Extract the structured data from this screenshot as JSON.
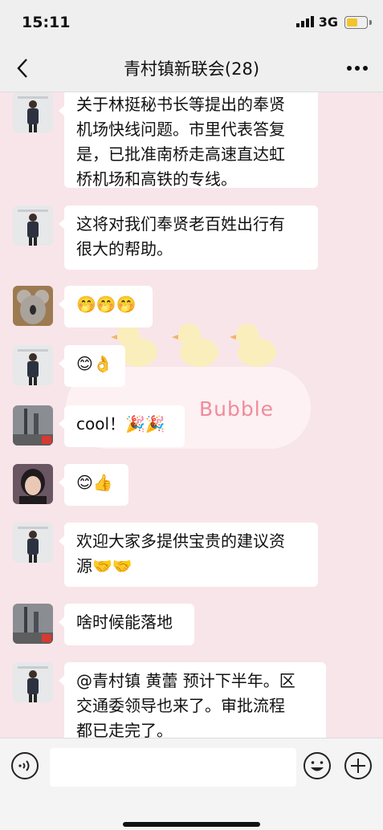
{
  "status": {
    "time": "15:11",
    "network": "3G"
  },
  "header": {
    "title": "青村镇新联会(28)"
  },
  "messages": [
    {
      "text": "关于林挺秘书长等提出的奉贤\n机场快线问题。市里代表答复\n是，已批准南桥走高速直达虹\n桥机场和高铁的专线。",
      "avatar": "man-photo-avatar"
    },
    {
      "text": "这将对我们奉贤老百姓出行有\n很大的帮助。",
      "avatar": "man-photo-avatar"
    },
    {
      "text": "🤭🤭🤭",
      "avatar": "koala-avatar"
    },
    {
      "text": "😊👌",
      "avatar": "man-photo-avatar"
    },
    {
      "text": "cool！🎉🎉",
      "avatar": "city-avatar"
    },
    {
      "text": "😊👍",
      "avatar": "woman-avatar"
    },
    {
      "text": "欢迎大家多提供宝贵的建议资\n源🤝🤝",
      "avatar": "man-photo-avatar"
    },
    {
      "text": "啥时候能落地",
      "avatar": "city-avatar"
    },
    {
      "text": "@青村镇 黄蕾 预计下半年。区\n交通委领导也来了。审批流程\n都已走完了。",
      "avatar": "man-photo-avatar"
    }
  ],
  "background": {
    "label": "Bubble"
  },
  "input": {
    "placeholder": ""
  },
  "colors": {
    "chat_bg": "#f8e5e9",
    "bubble": "#ffffff",
    "bar": "#efeff0"
  }
}
